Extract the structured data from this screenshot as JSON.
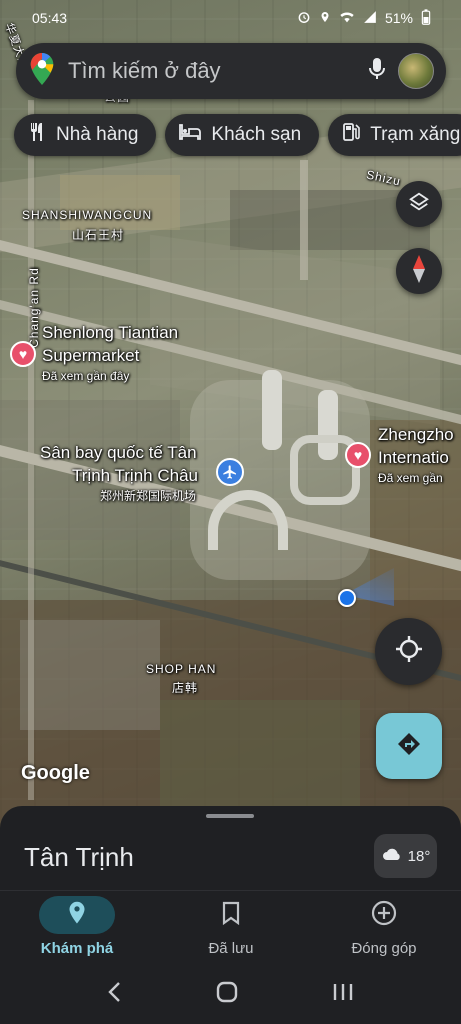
{
  "status_bar": {
    "time": "05:43",
    "battery": "51%"
  },
  "search": {
    "placeholder": "Tìm kiếm ở đây"
  },
  "chips": [
    {
      "label": "Nhà hàng",
      "icon": "restaurant-icon"
    },
    {
      "label": "Khách sạn",
      "icon": "hotel-icon"
    },
    {
      "label": "Trạm xăng",
      "icon": "gas-station-icon"
    }
  ],
  "map": {
    "area_labels": {
      "shanshiwangcun": "SHANSHIWANGCUN",
      "shanshiwangcun_cn": "山石王村",
      "shop_han": "SHOP HAN",
      "shop_han_cn": "店韩",
      "changan_rd": "Chang'an Rd",
      "shizu": "Shizu",
      "top_left_cn": "华夏大道",
      "top_partial": "公园"
    },
    "pois": {
      "supermarket": {
        "line1": "Shenlong Tiantian",
        "line2": "Supermarket",
        "sub": "Đã xem gần đây"
      },
      "airport": {
        "line1": "Sân bay quốc tế Tân",
        "line2": "Trịnh Trịnh Châu",
        "cn": "郑州新郑国际机场"
      },
      "zhengzhou": {
        "line1": "Zhengzho",
        "line2": "Internatio",
        "sub": "Đã xem gần"
      }
    },
    "attribution": "Google"
  },
  "sheet": {
    "title": "Tân Trịnh",
    "weather": "18°"
  },
  "bottom_nav": [
    {
      "label": "Khám phá",
      "icon": "explore-pin-icon",
      "active": true
    },
    {
      "label": "Đã lưu",
      "icon": "bookmark-icon",
      "active": false
    },
    {
      "label": "Đóng góp",
      "icon": "add-circle-icon",
      "active": false
    }
  ],
  "colors": {
    "accent": "#8fd3e3",
    "directions_button": "#78c8d6",
    "heart_pin": "#e8506b",
    "location_dot": "#1a73e8"
  }
}
